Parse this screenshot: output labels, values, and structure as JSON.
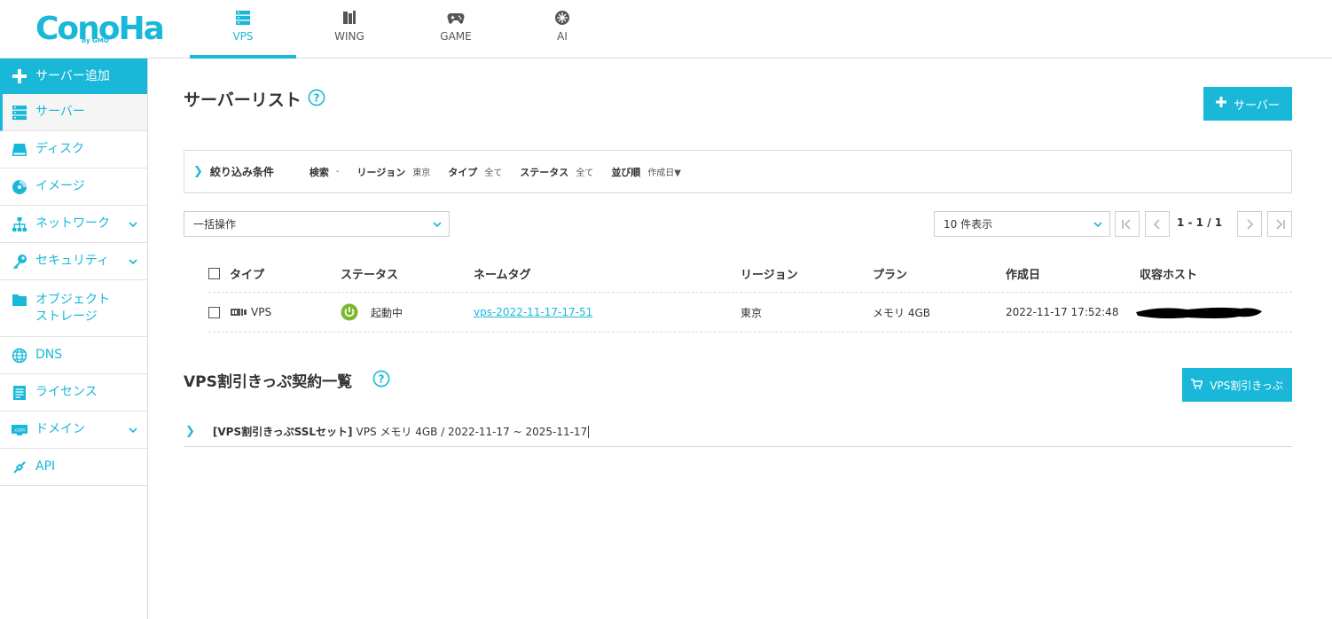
{
  "brand": {
    "logo_text": "ConoHa",
    "logo_sub": "by GMO"
  },
  "topnav": [
    {
      "label": "VPS",
      "icon": "server-icon",
      "active": true
    },
    {
      "label": "WING",
      "icon": "wing-icon",
      "active": false
    },
    {
      "label": "GAME",
      "icon": "gamepad-icon",
      "active": false
    },
    {
      "label": "AI",
      "icon": "ai-icon",
      "active": false
    }
  ],
  "sidebar": {
    "items": [
      {
        "label": "サーバー追加",
        "icon": "plus-icon"
      },
      {
        "label": "サーバー",
        "icon": "server-icon"
      },
      {
        "label": "ディスク",
        "icon": "disk-icon"
      },
      {
        "label": "イメージ",
        "icon": "image-disc-icon"
      },
      {
        "label": "ネットワーク",
        "icon": "network-icon",
        "expandable": true
      },
      {
        "label": "セキュリティ",
        "icon": "key-icon",
        "expandable": true
      },
      {
        "label": "オブジェクト\nストレージ",
        "line1": "オブジェクト",
        "line2": "ストレージ",
        "icon": "folder-icon"
      },
      {
        "label": "DNS",
        "icon": "globe-icon"
      },
      {
        "label": "ライセンス",
        "icon": "license-icon"
      },
      {
        "label": "ドメイン",
        "icon": "domain-icon",
        "expandable": true
      },
      {
        "label": "API",
        "icon": "api-icon"
      }
    ]
  },
  "server_list": {
    "title": "サーバーリスト",
    "add_button": "サーバー",
    "filter": {
      "toggle": "❯",
      "title": "絞り込み条件",
      "search_key": "検索",
      "search_val": "-",
      "region_key": "リージョン",
      "region_val": "東京",
      "type_key": "タイプ",
      "type_val": "全て",
      "status_key": "ステータス",
      "status_val": "全て",
      "sort_key": "並び順",
      "sort_val": "作成日▼"
    },
    "bulk_select": "一括操作",
    "per_page_select": "10 件表示",
    "pager_text": "1 - 1 / 1",
    "columns": [
      "タイプ",
      "ステータス",
      "ネームタグ",
      "リージョン",
      "プラン",
      "作成日",
      "収容ホスト"
    ],
    "rows": [
      {
        "type": "VPS",
        "status": "起動中",
        "name_tag": "vps-2022-11-17-17-51",
        "region": "東京",
        "plan": "メモリ 4GB",
        "created": "2022-11-17 17:52:48"
      }
    ]
  },
  "coupons": {
    "title": "VPS割引きっぷ契約一覧",
    "button": "VPS割引きっぷ",
    "toggle": "❯",
    "name": "[VPS割引きっぷSSLセット]",
    "detail": "VPS メモリ 4GB / 2022-11-17 ~ 2025-11-17"
  },
  "colors": {
    "accent": "#19b8d8",
    "status_running": "#7cb82f"
  }
}
